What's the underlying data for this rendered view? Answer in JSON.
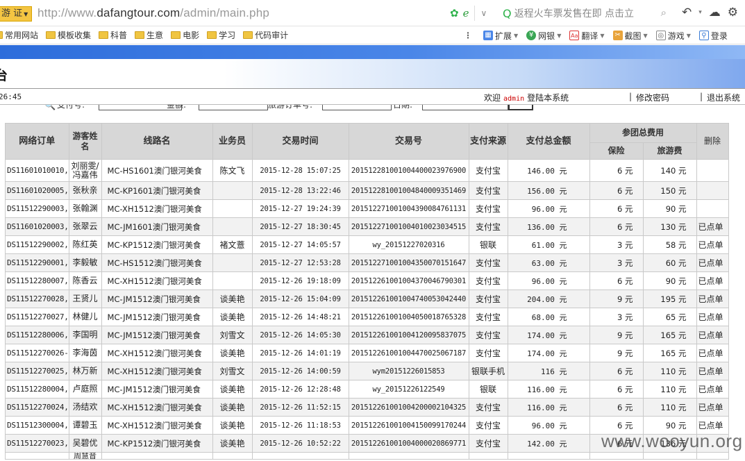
{
  "browser": {
    "tab_text": "游 证",
    "url_prefix": "http://www.",
    "url_domain": "dafangtour.com",
    "url_path": "/admin/main.php",
    "search_text": "返程火车票发售在即 点击立"
  },
  "bookmarks": [
    "常用网站",
    "模板收集",
    "科普",
    "生意",
    "电影",
    "学习",
    "代码审计"
  ],
  "toolbar": [
    "扩展",
    "网银",
    "翻译",
    "截图",
    "游戏",
    "登录"
  ],
  "header": {
    "title": "台",
    "time": "26:45",
    "welcome_prefix": "欢迎",
    "admin": "admin",
    "welcome_suffix": "登陆本系统",
    "change_password": "修改密码",
    "logout": "退出系统"
  },
  "filters": [
    "支付号:",
    "金额:",
    "旅游订单号:",
    "日期:"
  ],
  "table": {
    "headers": {
      "order": "网络订单",
      "guest": "游客姓名",
      "route": "线路名",
      "agent": "业务员",
      "time": "交易时间",
      "txn": "交易号",
      "source": "支付来源",
      "total": "支付总金额",
      "group_fee": "参团总费用",
      "insurance": "保险",
      "tour_fee": "旅游费",
      "delete": "删除"
    },
    "rows": [
      {
        "order": "DS11601010010,",
        "guest": "刘丽雯/冯嘉伟",
        "route": "MC-HS1601澳门银河美食",
        "agent": "陈文飞",
        "time": "2015-12-28 15:07:25",
        "txn": "201512281001004400023976900",
        "source": "支付宝",
        "total": "146.00 元",
        "ins": "6 元",
        "fee": "140 元",
        "status": ""
      },
      {
        "order": "DS11601020005,",
        "guest": "张秋亲",
        "route": "MC-KP1601澳门银河美食",
        "agent": "",
        "time": "2015-12-28 13:22:46",
        "txn": "201512281001004840009351469",
        "source": "支付宝",
        "total": "156.00 元",
        "ins": "6 元",
        "fee": "150 元",
        "status": ""
      },
      {
        "order": "DS11512290003,",
        "guest": "张翰渊",
        "route": "MC-XH1512澳门银河美食",
        "agent": "",
        "time": "2015-12-27 19:24:39",
        "txn": "201512271001004390084761131",
        "source": "支付宝",
        "total": "96.00 元",
        "ins": "6 元",
        "fee": "90 元",
        "status": ""
      },
      {
        "order": "DS11601020003,",
        "guest": "张翠云",
        "route": "MC-JM1601澳门银河美食",
        "agent": "",
        "time": "2015-12-27 18:30:45",
        "txn": "201512271001004010023034515",
        "source": "支付宝",
        "total": "136.00 元",
        "ins": "6 元",
        "fee": "130 元",
        "status": "已点单"
      },
      {
        "order": "DS11512290002,",
        "guest": "陈红英",
        "route": "MC-KP1512澳门银河美食",
        "agent": "褚文薏",
        "time": "2015-12-27 14:05:57",
        "txn": "wy_20151227020316",
        "source": "银联",
        "total": "61.00 元",
        "ins": "3 元",
        "fee": "58 元",
        "status": "已点单"
      },
      {
        "order": "DS11512290001,",
        "guest": "李毅敏",
        "route": "MC-HS1512澳门银河美食",
        "agent": "",
        "time": "2015-12-27 12:53:28",
        "txn": "201512271001004350070151647",
        "source": "支付宝",
        "total": "63.00 元",
        "ins": "3 元",
        "fee": "60 元",
        "status": "已点单"
      },
      {
        "order": "DS11512280007,",
        "guest": "陈香云",
        "route": "MC-XH1512澳门银河美食",
        "agent": "",
        "time": "2015-12-26 19:18:09",
        "txn": "201512261001004370046790301",
        "source": "支付宝",
        "total": "96.00 元",
        "ins": "6 元",
        "fee": "90 元",
        "status": "已点单"
      },
      {
        "order": "DS11512270028,",
        "guest": "王贤儿",
        "route": "MC-JM1512澳门银河美食",
        "agent": "谈美艳",
        "time": "2015-12-26 15:04:09",
        "txn": "201512261001004740053042440",
        "source": "支付宝",
        "total": "204.00 元",
        "ins": "9 元",
        "fee": "195 元",
        "status": "已点单"
      },
      {
        "order": "DS11512270027,",
        "guest": "林健儿",
        "route": "MC-JM1512澳门银河美食",
        "agent": "谈美艳",
        "time": "2015-12-26 14:48:21",
        "txn": "201512261001004050018765328",
        "source": "支付宝",
        "total": "68.00 元",
        "ins": "3 元",
        "fee": "65 元",
        "status": "已点单"
      },
      {
        "order": "DS11512280006,",
        "guest": "李国明",
        "route": "MC-JM1512澳门银河美食",
        "agent": "刘雪文",
        "time": "2015-12-26 14:05:30",
        "txn": "201512261001004120095837075",
        "source": "支付宝",
        "total": "174.00 元",
        "ins": "9 元",
        "fee": "165 元",
        "status": "已点单"
      },
      {
        "order": "DS11512270026-",
        "guest": "李海茵",
        "route": "MC-XH1512澳门银河美食",
        "agent": "谈美艳",
        "time": "2015-12-26 14:01:19",
        "txn": "201512261001004470025067187",
        "source": "支付宝",
        "total": "174.00 元",
        "ins": "9 元",
        "fee": "165 元",
        "status": "已点单"
      },
      {
        "order": "DS11512270025,",
        "guest": "林万新",
        "route": "MC-XH1512澳门银河美食",
        "agent": "刘雪文",
        "time": "2015-12-26 14:00:59",
        "txn": "wym20151226015853",
        "source": "银联手机",
        "total": "116 元",
        "ins": "6 元",
        "fee": "110 元",
        "status": "已点单"
      },
      {
        "order": "DS11512280004,",
        "guest": "卢庭照",
        "route": "MC-JM1512澳门银河美食",
        "agent": "谈美艳",
        "time": "2015-12-26 12:28:48",
        "txn": "wy_20151226122549",
        "source": "银联",
        "total": "116.00 元",
        "ins": "6 元",
        "fee": "110 元",
        "status": "已点单"
      },
      {
        "order": "DS11512270024,",
        "guest": "汤结欢",
        "route": "MC-XH1512澳门银河美食",
        "agent": "谈美艳",
        "time": "2015-12-26 11:52:15",
        "txn": "201512261001004200002104325",
        "source": "支付宝",
        "total": "116.00 元",
        "ins": "6 元",
        "fee": "110 元",
        "status": "已点单"
      },
      {
        "order": "DS11512300004,",
        "guest": "谭碧玉",
        "route": "MC-XH1512澳门银河美食",
        "agent": "谈美艳",
        "time": "2015-12-26 11:18:53",
        "txn": "201512261001004150099170244",
        "source": "支付宝",
        "total": "96.00 元",
        "ins": "6 元",
        "fee": "90 元",
        "status": "已点单"
      },
      {
        "order": "DS11512270023,",
        "guest": "吴碧优",
        "route": "MC-KP1512澳门银河美食",
        "agent": "谈美艳",
        "time": "2015-12-26 10:52:22",
        "txn": "201512261001004000020869771",
        "source": "支付宝",
        "total": "142.00 元",
        "ins": "6 元",
        "fee": "136 元",
        "status": ""
      },
      {
        "order": "",
        "guest": "周慧音",
        "route": "",
        "agent": "",
        "time": "",
        "txn": "",
        "source": "",
        "total": "",
        "ins": "",
        "fee": "",
        "status": ""
      }
    ]
  },
  "watermark": "www.wooyun.org"
}
